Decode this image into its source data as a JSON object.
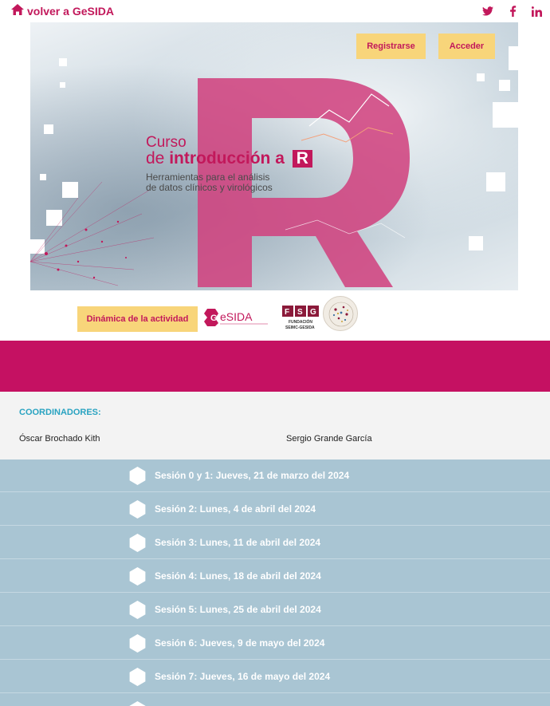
{
  "header": {
    "back_label": "volver a GeSIDA",
    "social": [
      "twitter-icon",
      "facebook-icon",
      "linkedin-icon"
    ]
  },
  "banner": {
    "register_label": "Registrarse",
    "login_label": "Acceder",
    "title_line1": "Curso",
    "title_line2_prefix": "de",
    "title_line2_bold": "introducción a",
    "title_letter": "R",
    "subtitle_line1": "Herramientas para el análisis",
    "subtitle_line2": "de datos clínicos y virológicos"
  },
  "activity": {
    "dynamic_label": "Dinámica de la actividad",
    "gesida_logo_text": "GeSIDA",
    "fsg_logo_text": "FSG",
    "fsg_sub_text": "FUNDACIÓN SEIMC-GESIDA"
  },
  "coordinators": {
    "title": "COORDINADORES:",
    "names": [
      "Óscar Brochado Kith",
      "Sergio Grande García"
    ]
  },
  "sessions": [
    "Sesión 0 y 1: Jueves, 21 de marzo del 2024",
    "Sesión 2: Lunes, 4 de abril del 2024",
    "Sesión 3: Lunes, 11 de abril del 2024",
    "Sesión 4: Lunes, 18 de abril del 2024",
    "Sesión 5: Lunes, 25 de abril del 2024",
    "Sesión 6: Jueves, 9 de mayo del 2024",
    "Sesión 7: Jueves, 16 de mayo del 2024",
    ""
  ],
  "colors": {
    "brand_pink": "#c2185b",
    "band_pink": "#c51162",
    "button_yellow": "#f8d57a",
    "coord_blue": "#29a3c1",
    "sessions_bg": "#a9c5d3"
  }
}
